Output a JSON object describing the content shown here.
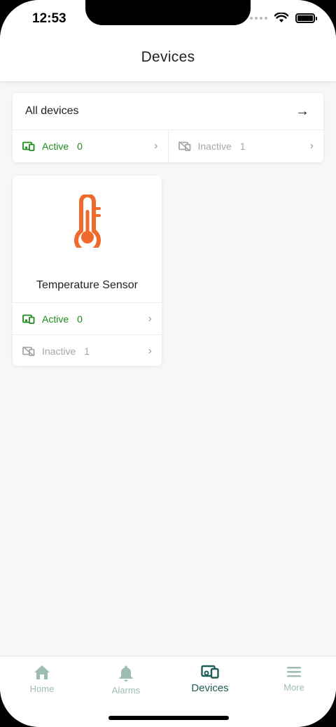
{
  "status_bar": {
    "time": "12:53"
  },
  "header": {
    "title": "Devices"
  },
  "all_devices": {
    "title": "All devices",
    "active": {
      "label": "Active",
      "count": "0"
    },
    "inactive": {
      "label": "Inactive",
      "count": "1"
    }
  },
  "device_types": [
    {
      "name": "Temperature Sensor",
      "icon": "thermometer-icon",
      "active": {
        "label": "Active",
        "count": "0"
      },
      "inactive": {
        "label": "Inactive",
        "count": "1"
      }
    }
  ],
  "nav": {
    "items": [
      {
        "label": "Home",
        "icon": "home-icon"
      },
      {
        "label": "Alarms",
        "icon": "bell-icon"
      },
      {
        "label": "Devices",
        "icon": "devices-icon",
        "selected": true
      },
      {
        "label": "More",
        "icon": "menu-icon"
      }
    ]
  },
  "colors": {
    "active": "#1f8a1f",
    "inactive": "#a6a6a6",
    "accent": "#1f5e57",
    "nav_inactive": "#9fbcb4",
    "thermometer": "#f06a2e"
  }
}
